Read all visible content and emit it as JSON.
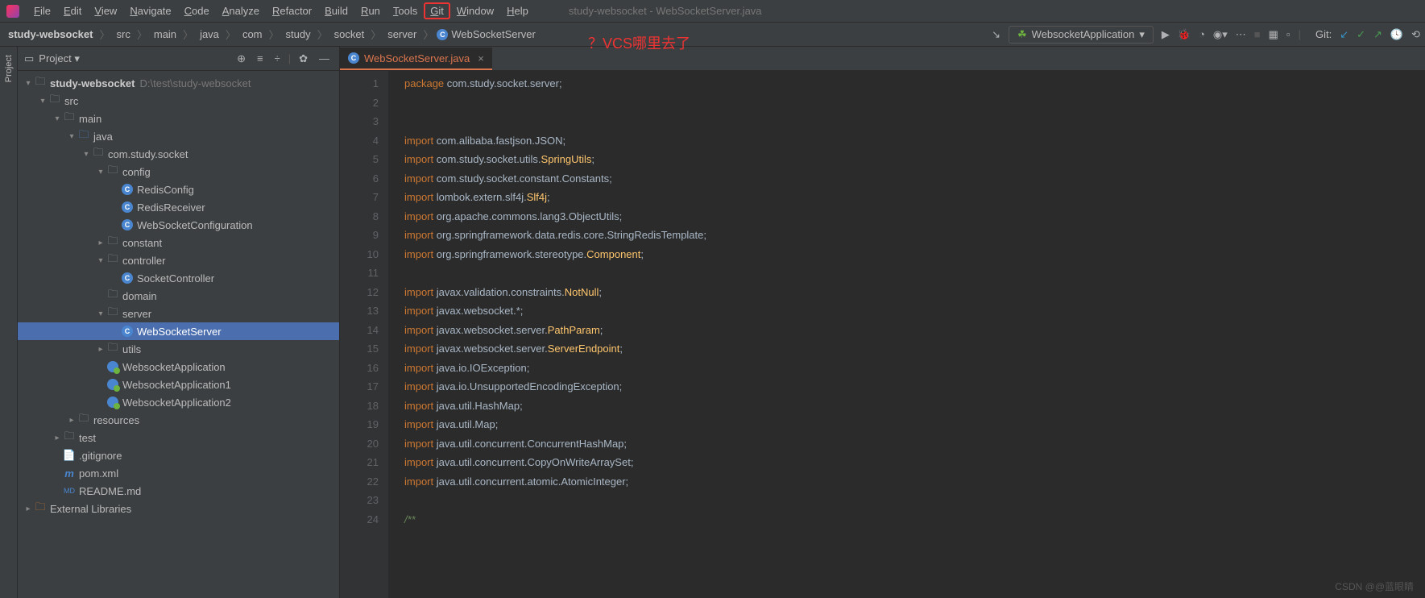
{
  "window_title": "study-websocket - WebSocketServer.java",
  "annotation": "？VCS哪里去了",
  "menus": [
    "File",
    "Edit",
    "View",
    "Navigate",
    "Code",
    "Analyze",
    "Refactor",
    "Build",
    "Run",
    "Tools",
    "Git",
    "Window",
    "Help"
  ],
  "breadcrumb": [
    "study-websocket",
    "src",
    "main",
    "java",
    "com",
    "study",
    "socket",
    "server"
  ],
  "breadcrumb_class": "WebSocketServer",
  "run_config": "WebsocketApplication",
  "git_label": "Git:",
  "panel": {
    "title": "Project"
  },
  "tree": {
    "root": "study-websocket",
    "root_path": "D:\\test\\study-websocket",
    "src": "src",
    "main": "main",
    "java": "java",
    "pkg": "com.study.socket",
    "config": "config",
    "redisConfig": "RedisConfig",
    "redisReceiver": "RedisReceiver",
    "wsConfig": "WebSocketConfiguration",
    "constant": "constant",
    "controller": "controller",
    "socketController": "SocketController",
    "domain": "domain",
    "server": "server",
    "wsServer": "WebSocketServer",
    "utils": "utils",
    "app1": "WebsocketApplication",
    "app2": "WebsocketApplication1",
    "app3": "WebsocketApplication2",
    "resources": "resources",
    "test": "test",
    "gitignore": ".gitignore",
    "pom": "pom.xml",
    "readme": "README.md",
    "extLib": "External Libraries"
  },
  "tab": {
    "label": "WebSocketServer.java"
  },
  "code": {
    "lines": [
      {
        "n": 1,
        "t": "package",
        "r": " com.study.socket.server;"
      },
      {
        "n": 2,
        "t": "",
        "r": ""
      },
      {
        "n": 3,
        "t": "",
        "r": ""
      },
      {
        "n": 4,
        "t": "import",
        "r": " com.alibaba.fastjson.JSON;"
      },
      {
        "n": 5,
        "t": "import",
        "r": " com.study.socket.utils.",
        "hl": "SpringUtils",
        "r2": ";"
      },
      {
        "n": 6,
        "t": "import",
        "r": " com.study.socket.constant.Constants;"
      },
      {
        "n": 7,
        "t": "import",
        "r": " lombok.extern.slf4j.",
        "hl": "Slf4j",
        "r2": ";"
      },
      {
        "n": 8,
        "t": "import",
        "r": " org.apache.commons.lang3.ObjectUtils;"
      },
      {
        "n": 9,
        "t": "import",
        "r": " org.springframework.data.redis.core.StringRedisTemplate;"
      },
      {
        "n": 10,
        "t": "import",
        "r": " org.springframework.stereotype.",
        "hl": "Component",
        "r2": ";"
      },
      {
        "n": 11,
        "t": "",
        "r": ""
      },
      {
        "n": 12,
        "t": "import",
        "r": " javax.validation.constraints.",
        "hl": "NotNull",
        "r2": ";"
      },
      {
        "n": 13,
        "t": "import",
        "r": " javax.websocket.*;"
      },
      {
        "n": 14,
        "t": "import",
        "r": " javax.websocket.server.",
        "hl": "PathParam",
        "r2": ";"
      },
      {
        "n": 15,
        "t": "import",
        "r": " javax.websocket.server.",
        "hl": "ServerEndpoint",
        "r2": ";"
      },
      {
        "n": 16,
        "t": "import",
        "r": " java.io.IOException;"
      },
      {
        "n": 17,
        "t": "import",
        "r": " java.io.UnsupportedEncodingException;"
      },
      {
        "n": 18,
        "t": "import",
        "r": " java.util.HashMap;"
      },
      {
        "n": 19,
        "t": "import",
        "r": " java.util.Map;"
      },
      {
        "n": 20,
        "t": "import",
        "r": " java.util.concurrent.ConcurrentHashMap;"
      },
      {
        "n": 21,
        "t": "import",
        "r": " java.util.concurrent.CopyOnWriteArraySet;"
      },
      {
        "n": 22,
        "t": "import",
        "r": " java.util.concurrent.atomic.AtomicInteger;"
      },
      {
        "n": 23,
        "t": "",
        "r": ""
      },
      {
        "n": 24,
        "t": "",
        "r": "/**",
        "comment": true
      }
    ]
  },
  "watermark": "CSDN @@蓝眼睛"
}
